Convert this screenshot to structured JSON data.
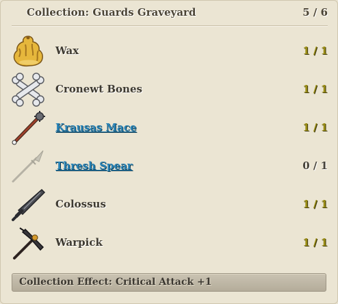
{
  "collection": {
    "title": "Collection: Guards Graveyard",
    "progress": "5 / 6"
  },
  "items": [
    {
      "name": "Wax",
      "qty": "1 / 1",
      "linked": false,
      "complete": true,
      "icon": "wax-icon"
    },
    {
      "name": "Cronewt Bones",
      "qty": "1 / 1",
      "linked": false,
      "complete": true,
      "icon": "crossed-bones-icon"
    },
    {
      "name": "Krausas Mace",
      "qty": "1 / 1",
      "linked": true,
      "complete": true,
      "icon": "mace-icon"
    },
    {
      "name": "Thresh Spear",
      "qty": "0 / 1",
      "linked": true,
      "complete": false,
      "icon": "spear-icon"
    },
    {
      "name": "Colossus",
      "qty": "1 / 1",
      "linked": false,
      "complete": true,
      "icon": "greatsword-icon"
    },
    {
      "name": "Warpick",
      "qty": "1 / 1",
      "linked": false,
      "complete": true,
      "icon": "warpick-icon"
    }
  ],
  "effect": {
    "text": "Collection Effect: Critical Attack +1"
  },
  "colors": {
    "complete_qty": "#9a8d14",
    "missing_qty": "#46423a",
    "link": "#2a84b7",
    "background": "#ebe5d3"
  }
}
